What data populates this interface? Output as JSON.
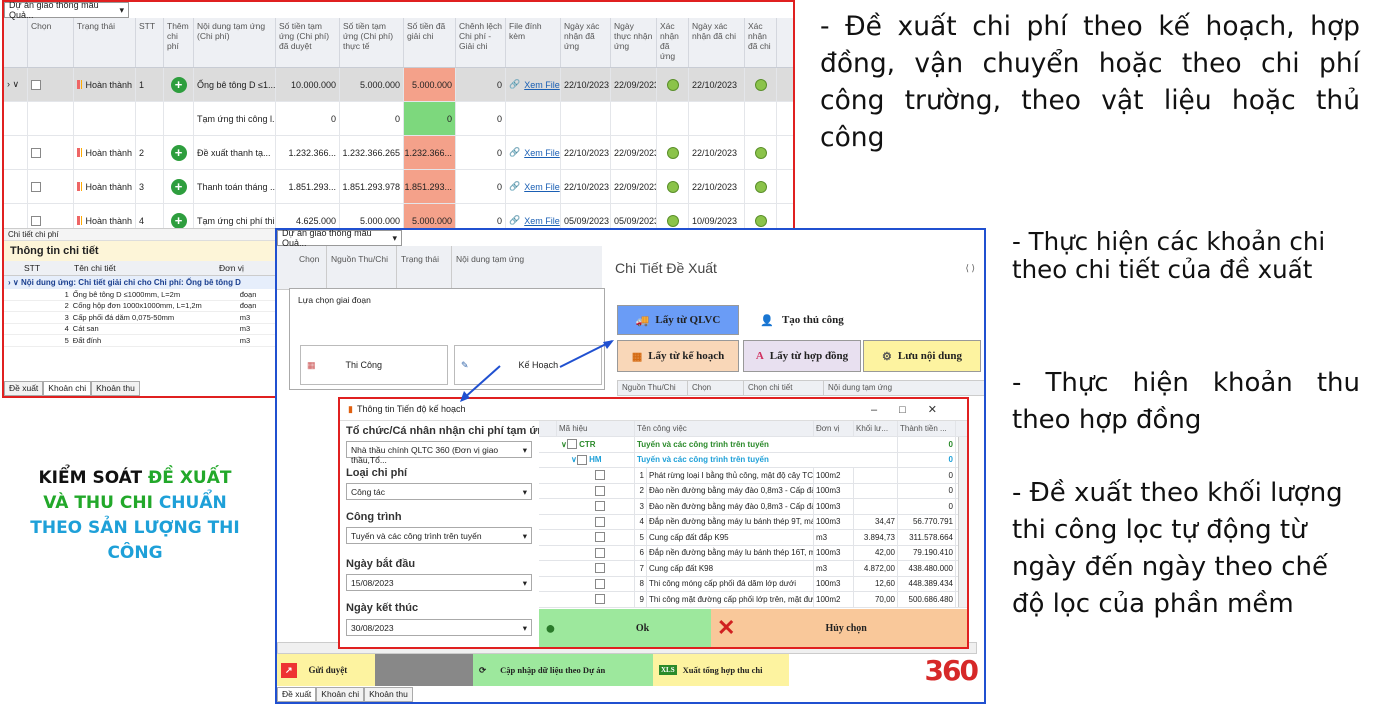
{
  "win1": {
    "project_select": "Dự án giao thông mẫu Quả...",
    "headers": [
      "Chọn",
      "Trạng thái",
      "STT",
      "Thêm chi phí",
      "Nội dung tạm ứng (Chi phí)",
      "Số tiền tạm ứng (Chi phí) đã duyệt",
      "Số tiền tạm ứng (Chi phí) thực tế",
      "Số tiền đã giải chi",
      "Chênh lệch Chi phí - Giải chi",
      "File đính kèm",
      "Ngày xác nhận đã ứng",
      "Ngày thực nhận ứng",
      "Xác nhận đã ứng",
      "Ngày xác nhận đã chi",
      "Xác nhận đã chi"
    ],
    "rows": [
      {
        "status": "Hoàn thành",
        "stt": "1",
        "content": "Ống bê tông D ≤1...",
        "approved": "10.000.000",
        "actual": "5.000.000",
        "spent": "5.000.000",
        "diff": "0",
        "file": "Xem File",
        "d1": "22/10/2023",
        "d2": "22/09/2023",
        "d3": "22/10/2023"
      },
      {
        "status": "",
        "stt": "",
        "content": "Tạm ứng thi công l...",
        "approved": "0",
        "actual": "0",
        "spent": "0",
        "diff": "0",
        "file": "",
        "d1": "",
        "d2": "",
        "d3": ""
      },
      {
        "status": "Hoàn thành",
        "stt": "2",
        "content": "Đề xuất thanh tạ...",
        "approved": "1.232.366...",
        "actual": "1.232.366.265",
        "spent": "1.232.366...",
        "diff": "0",
        "file": "Xem File",
        "d1": "22/10/2023",
        "d2": "22/09/2023",
        "d3": "22/10/2023"
      },
      {
        "status": "Hoàn thành",
        "stt": "3",
        "content": "Thanh toán tháng ...",
        "approved": "1.851.293...",
        "actual": "1.851.293.978",
        "spent": "1.851.293...",
        "diff": "0",
        "file": "Xem File",
        "d1": "22/10/2023",
        "d2": "22/09/2023",
        "d3": "22/10/2023"
      },
      {
        "status": "Hoàn thành",
        "stt": "4",
        "content": "Tạm ứng chi phí thi...",
        "approved": "4.625.000",
        "actual": "5.000.000",
        "spent": "5.000.000",
        "diff": "0",
        "file": "Xem File",
        "d1": "05/09/2023",
        "d2": "05/09/2023",
        "d3": "10/09/2023"
      }
    ],
    "detail_tab": "Chi tiết chi phí",
    "detail_title": "Thông tin chi tiết",
    "detail_cols": [
      "STT",
      "Tên chi tiết",
      "Đơn vị"
    ],
    "group_row": "Nội dung ứng: Chi tiết giải chi cho Chi phí: Ống bê tông D",
    "detail_rows": [
      {
        "stt": "1",
        "name": "Ống bê tông D ≤1000mm, L=2m",
        "unit": "đoạn"
      },
      {
        "stt": "2",
        "name": "Cống hộp đơn 1000x1000mm, L=1,2m",
        "unit": "đoạn"
      },
      {
        "stt": "3",
        "name": "Cấp phối đá dăm 0,075-50mm",
        "unit": "m3"
      },
      {
        "stt": "4",
        "name": "Cát san",
        "unit": "m3"
      },
      {
        "stt": "5",
        "name": "Đất đính",
        "unit": "m3"
      }
    ],
    "tabs": [
      "Đề xuất",
      "Khoản chi",
      "Khoản thu"
    ]
  },
  "win2": {
    "project_select": "Dự án giao thông mẫu Quả...",
    "headers": [
      "Chọn",
      "Nguồn Thu/Chi",
      "Trạng thái",
      "Nội dung tạm ứng"
    ],
    "phase_title": "Lựa chọn giai đoạn",
    "phase_a": "Thi Công",
    "phase_b": "Kế Hoạch",
    "panel_title": "Chi Tiết Đề Xuất",
    "btn_qlvc": "Lấy từ QLVC",
    "btn_manual": "Tạo thủ công",
    "btn_plan": "Lấy từ kế hoạch",
    "btn_contract": "Lấy từ hợp đồng",
    "btn_save": "Lưu nội dung",
    "sub_headers": [
      "Nguồn Thu/Chi",
      "Chọn",
      "Chọn chi tiết",
      "Nội dung tạm ứng"
    ],
    "bottom_approve": "Gửi duyệt",
    "bottom_update": "Cập nhập dữ liệu theo Dự án",
    "bottom_export": "Xuất tổng hợp thu chi",
    "tabs": [
      "Đề xuất",
      "Khoản chi",
      "Khoản thu"
    ],
    "logo": "360"
  },
  "win3": {
    "title": "Thông tin Tiến độ kế hoạch",
    "org_label": "Tổ chức/Cá nhân nhận chi phí tạm ứng",
    "org_value": "Nhà thầu chính QLTC 360 (Đơn vị giao thầu,Tổ...",
    "cost_label": "Loại chi phí",
    "cost_value": "Công tác",
    "work_label": "Công trình",
    "work_value": "Tuyến và các công trình trên tuyến",
    "start_label": "Ngày bắt đầu",
    "start_value": "15/08/2023",
    "end_label": "Ngày kết thúc",
    "end_value": "30/08/2023",
    "cols": [
      "Mã hiệu",
      "Tên công việc",
      "Đơn vị",
      "Khối lư...",
      "Thành tiền ..."
    ],
    "group1_code": "CTR",
    "group1_name": "Tuyến và các công trình trên tuyến",
    "group1_val": "0",
    "group2_code": "HM",
    "group2_name": "Tuyến và các công trình trên tuyến",
    "group2_val": "0",
    "rows": [
      {
        "n": "1",
        "name": "Phát rừng loại I bằng thủ công, mật độ cây TC...",
        "unit": "100m2",
        "qty": "",
        "amt": "0"
      },
      {
        "n": "2",
        "name": "Đào nền đường bằng máy đào 0,8m3 - Cấp đất I",
        "unit": "100m3",
        "qty": "",
        "amt": "0"
      },
      {
        "n": "3",
        "name": "Đào nền đường bằng máy đào 0,8m3 - Cấp đấ...",
        "unit": "100m3",
        "qty": "",
        "amt": "0"
      },
      {
        "n": "4",
        "name": "Đắp nền đường bằng máy lu bánh thép 9T, má...",
        "unit": "100m3",
        "qty": "34,47",
        "amt": "56.770.791"
      },
      {
        "n": "5",
        "name": "Cung cấp đất đắp K95",
        "unit": "m3",
        "qty": "3.894,73",
        "amt": "311.578.664"
      },
      {
        "n": "6",
        "name": "Đắp nền đường bằng máy lu bánh thép 16T, m...",
        "unit": "100m3",
        "qty": "42,00",
        "amt": "79.190.410"
      },
      {
        "n": "7",
        "name": "Cung cấp đất K98",
        "unit": "m3",
        "qty": "4.872,00",
        "amt": "438.480.000"
      },
      {
        "n": "8",
        "name": "Thi công móng cấp phối đá dăm lớp dưới",
        "unit": "100m3",
        "qty": "12,60",
        "amt": "448.389.434"
      },
      {
        "n": "9",
        "name": "Thi công mặt đường cấp phối lớp trên, mặt đư...",
        "unit": "100m2",
        "qty": "70,00",
        "amt": "500.686.480"
      }
    ],
    "ok": "Ok",
    "cancel": "Hủy chọn"
  },
  "text": {
    "right_top": "- Đề xuất chi phí theo kế hoạch, hợp đồng, vận chuyển hoặc theo chi phí công trường, theo vật liệu hoặc thủ công",
    "right_1": "- Thực hiện các khoản chi theo chi tiết của đề xuất",
    "right_2": "- Thực hiện khoản thu theo hợp đồng",
    "right_3": "- Đề xuất theo khối lượng thi công lọc tự động từ ngày đến ngày theo chế độ lọc của phần mềm",
    "left_a": "KIỂM SOÁT ",
    "left_b": "ĐỀ XUẤT VÀ THU CHI ",
    "left_c": "CHUẨN THEO SẢN LƯỢNG THI CÔNG"
  },
  "colors": {
    "red_border": "#e02020",
    "blue_border": "#2050d0",
    "green": "#22a82a",
    "blue": "#1ea0d8"
  }
}
